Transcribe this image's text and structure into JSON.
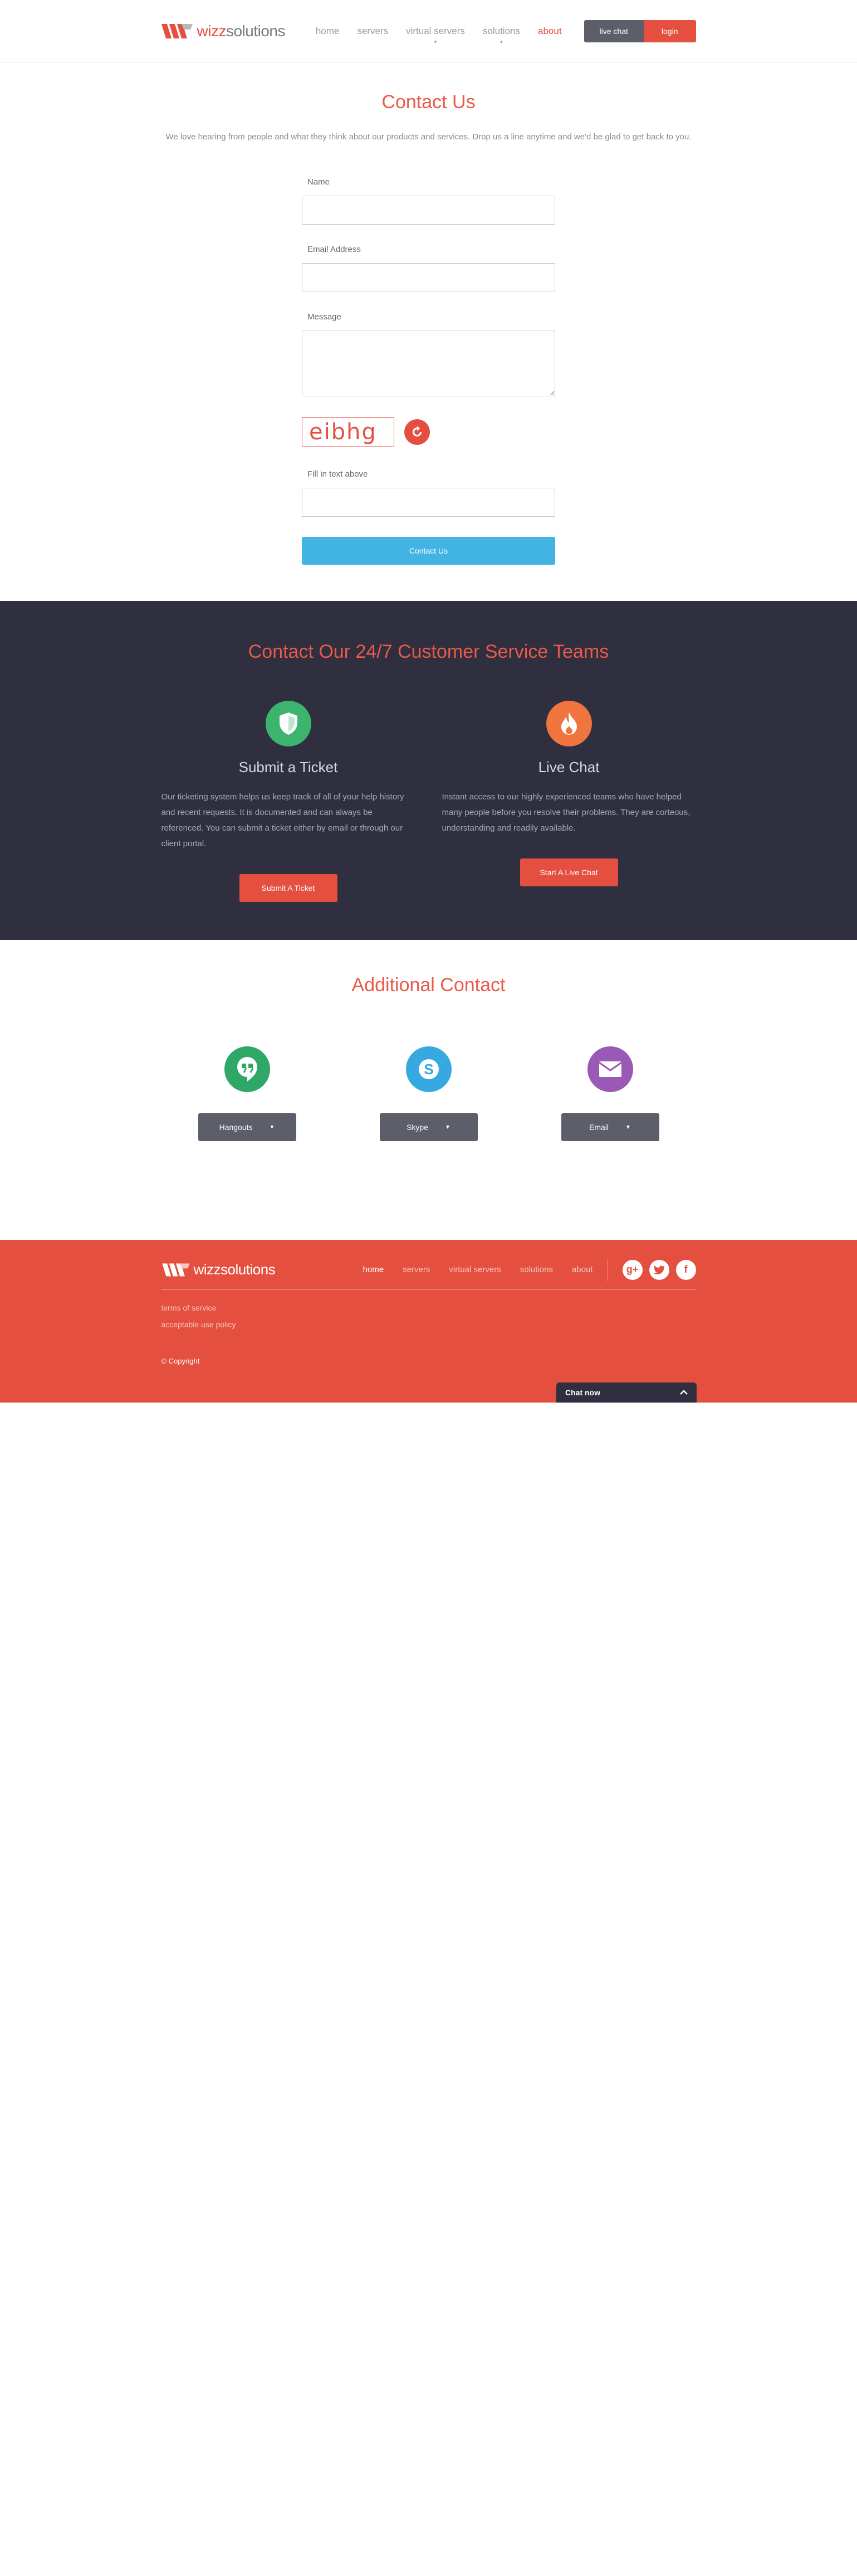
{
  "header": {
    "logo": {
      "part1": "wizz",
      "part2": "solutions"
    },
    "nav": [
      {
        "label": "home",
        "has_caret": false
      },
      {
        "label": "servers",
        "has_caret": false
      },
      {
        "label": "virtual servers",
        "has_caret": true
      },
      {
        "label": "solutions",
        "has_caret": true
      },
      {
        "label": "about",
        "has_caret": false,
        "active": true
      }
    ],
    "live_chat_label": "live chat",
    "login_label": "login"
  },
  "contact": {
    "title": "Contact Us",
    "lead": "We love hearing from people and what they think about our products and services. Drop us a line anytime and we'd be glad to get back to you.",
    "name_label": "Name",
    "email_label": "Email Address",
    "message_label": "Message",
    "captcha_text": "eibhg",
    "captcha_input_label": "Fill in text above",
    "submit_label": "Contact Us"
  },
  "teams": {
    "title": "Contact Our 24/7 Customer Service Teams",
    "ticket": {
      "title": "Submit a Ticket",
      "text": "Our ticketing system helps us keep track of all of your help history and recent requests. It is documented and can always be referenced. You can submit a ticket either by email or through our client portal.",
      "button": "Submit A Ticket",
      "color": "#3cb46e"
    },
    "chat": {
      "title": "Live Chat",
      "text": "Instant access to our highly experienced teams who have helped many people before you resolve their problems. They are corteous, understanding and readily available.",
      "button": "Start A Live Chat",
      "color": "#f0743d"
    }
  },
  "additional": {
    "title": "Additional Contact",
    "items": [
      {
        "label": "Hangouts",
        "icon": "hangouts-icon",
        "color": "#2fa766"
      },
      {
        "label": "Skype",
        "icon": "skype-icon",
        "color": "#36a9e1"
      },
      {
        "label": "Email",
        "icon": "email-icon",
        "color": "#9b59b6"
      }
    ]
  },
  "footer": {
    "logo_text": "wizzsolutions",
    "nav": [
      "home",
      "servers",
      "virtual servers",
      "solutions",
      "about"
    ],
    "links": [
      "terms of service",
      "acceptable use policy"
    ],
    "copyright": "© Copyright",
    "chat_label": "Chat now"
  },
  "colors": {
    "accent": "#e44f3f",
    "dark": "#2f2f3f",
    "blue": "#42b4e3"
  }
}
